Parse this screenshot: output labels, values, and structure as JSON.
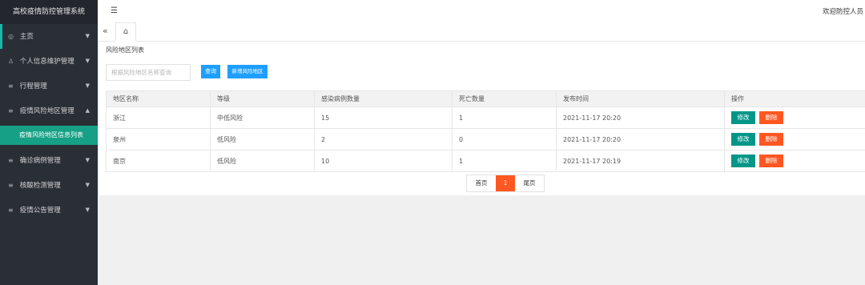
{
  "app": {
    "title": "高校疫情防控管理系统"
  },
  "header": {
    "menu_toggle_glyph": "☰",
    "welcome": "欢迎防控人员"
  },
  "tabs": {
    "prev_glyph": "«",
    "home_glyph": "⌂"
  },
  "sidebar": {
    "items": [
      {
        "label": "主页",
        "icon": "dashboard-icon",
        "glyph": "◎",
        "arrow": "▼"
      },
      {
        "label": "个人信息维护管理",
        "icon": "user-icon",
        "glyph": "♙",
        "arrow": "▼"
      },
      {
        "label": "行程管理",
        "icon": "list-icon",
        "glyph": "≡",
        "arrow": "▼"
      },
      {
        "label": "疫情风险地区管理",
        "icon": "list-icon",
        "glyph": "≡",
        "arrow": "▲"
      },
      {
        "label": "确诊病例管理",
        "icon": "list-icon",
        "glyph": "≡",
        "arrow": "▼"
      },
      {
        "label": "核酸检测管理",
        "icon": "list-icon",
        "glyph": "≡",
        "arrow": "▼"
      },
      {
        "label": "疫情公告管理",
        "icon": "list-icon",
        "glyph": "≡",
        "arrow": "▼"
      }
    ],
    "subitem": {
      "label": "疫情风险地区信息列表"
    }
  },
  "main": {
    "title": "风险地区列表",
    "search": {
      "placeholder": "根据风险地区名称查询",
      "value": ""
    },
    "query_label": "查询",
    "add_label": "新增风险地区",
    "columns": [
      "地区名称",
      "等级",
      "感染病例数量",
      "死亡数量",
      "发布时间",
      "操作"
    ],
    "rows": [
      {
        "name": "浙江",
        "level": "中低风险",
        "infected": "15",
        "deaths": "1",
        "time": "2021-11-17 20:20"
      },
      {
        "name": "泉州",
        "level": "低风险",
        "infected": "2",
        "deaths": "0",
        "time": "2021-11-17 20:20"
      },
      {
        "name": "南京",
        "level": "低风险",
        "infected": "10",
        "deaths": "1",
        "time": "2021-11-17 20:19"
      }
    ],
    "edit_label": "修改",
    "delete_label": "删除",
    "pager": {
      "first": "首页",
      "current": "1",
      "last": "尾页"
    }
  },
  "colors": {
    "sidebar_bg": "#2a2f36",
    "accent_teal": "#009688",
    "primary_blue": "#1e9fff",
    "danger_orange": "#ff5722"
  }
}
